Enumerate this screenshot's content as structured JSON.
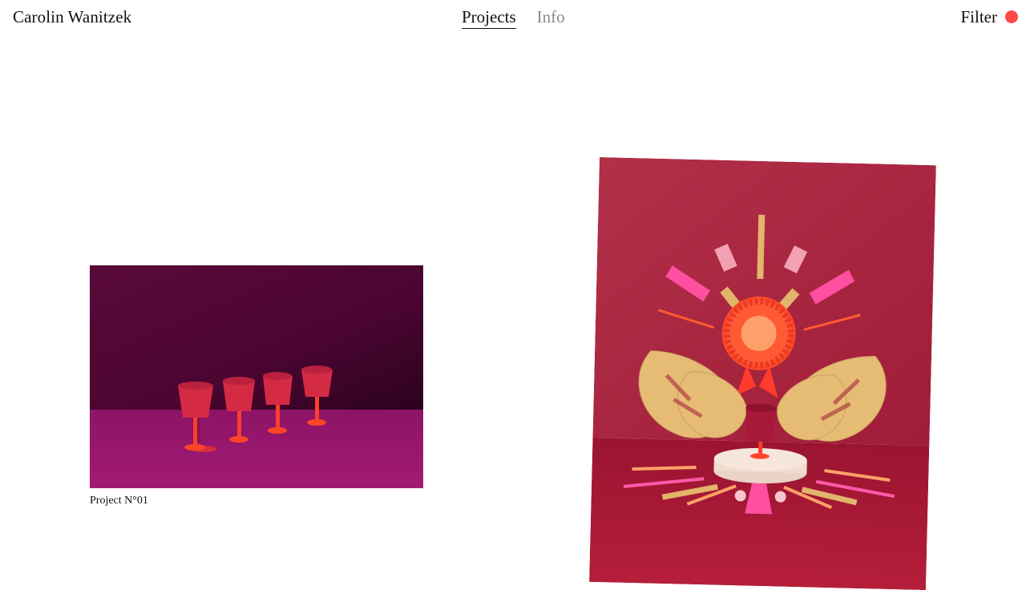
{
  "header": {
    "site_title": "Carolin Wanitzek",
    "nav": [
      {
        "label": "Projects",
        "active": true
      },
      {
        "label": "Info",
        "active": false
      }
    ],
    "filter_label": "Filter",
    "filter_dot_color": "#ff4a4a"
  },
  "projects": [
    {
      "caption": "Project N°01"
    },
    {
      "caption": ""
    }
  ]
}
